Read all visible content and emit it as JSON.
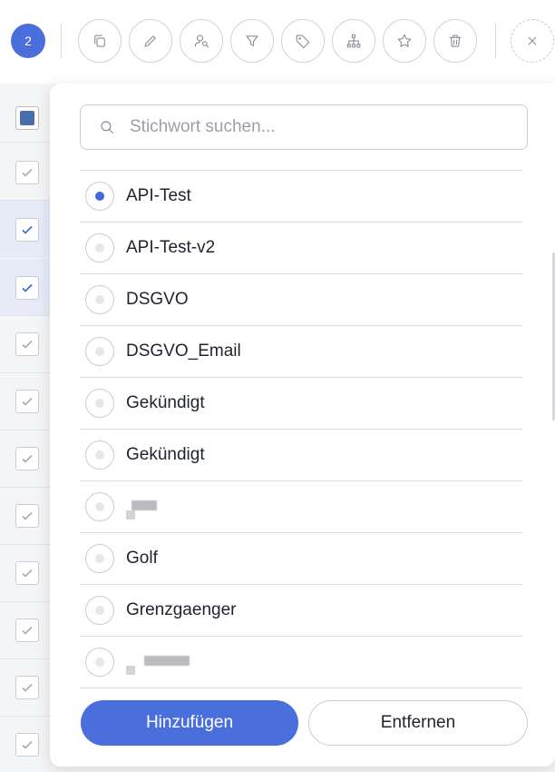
{
  "toolbar": {
    "selected_count": "2",
    "buttons": [
      {
        "icon": "copy-icon"
      },
      {
        "icon": "pencil-icon"
      },
      {
        "icon": "user-search-icon"
      },
      {
        "icon": "filter-icon"
      },
      {
        "icon": "tag-icon"
      },
      {
        "icon": "hierarchy-icon"
      },
      {
        "icon": "star-icon"
      },
      {
        "icon": "trash-icon"
      }
    ],
    "close_icon": "close-icon"
  },
  "tag_dropdown": {
    "search_placeholder": "Stichwort suchen...",
    "search_value": "",
    "items": [
      {
        "label": "API-Test",
        "selected": true
      },
      {
        "label": "API-Test-v2",
        "selected": false
      },
      {
        "label": "DSGVO",
        "selected": false
      },
      {
        "label": "DSGVO_Email",
        "selected": false
      },
      {
        "label": "Gekündigt",
        "selected": false
      },
      {
        "label": "Gekündigt",
        "selected": false
      },
      {
        "label": "",
        "selected": false,
        "redacted": true
      },
      {
        "label": "Golf",
        "selected": false
      },
      {
        "label": "Grenzgaenger",
        "selected": false
      },
      {
        "label": "",
        "selected": false,
        "redacted": true
      }
    ],
    "add_button": "Hinzufügen",
    "remove_button": "Entfernen"
  },
  "colors": {
    "accent": "#4a6fdd",
    "selected_radio": "#3f66de",
    "row_highlight": "#e8ecf8"
  }
}
